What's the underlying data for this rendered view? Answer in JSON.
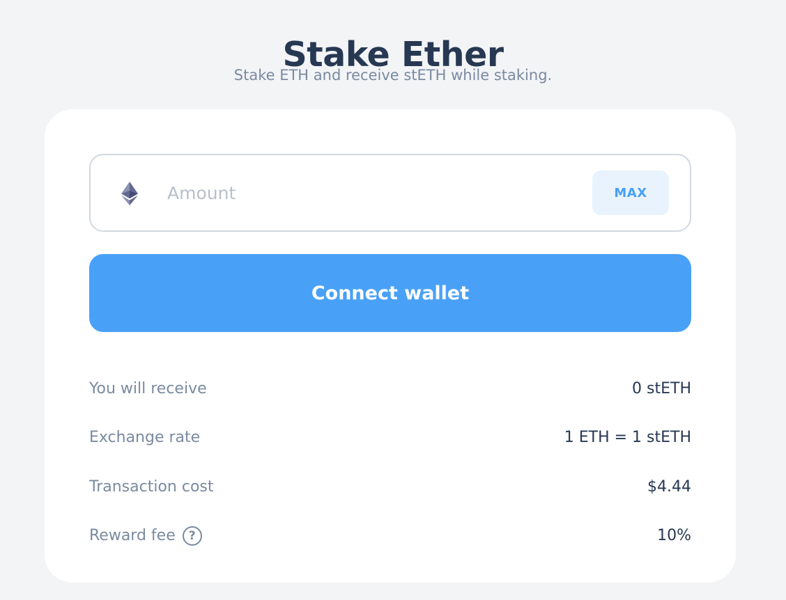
{
  "header": {
    "title": "Stake Ether",
    "subtitle": "Stake ETH and receive stETH while staking."
  },
  "form": {
    "token_icon": "ethereum-icon",
    "amount_placeholder": "Amount",
    "amount_value": "",
    "max_label": "MAX",
    "connect_label": "Connect wallet"
  },
  "details": [
    {
      "label": "You will receive",
      "value": "0 stETH",
      "help": false
    },
    {
      "label": "Exchange rate",
      "value": "1 ETH = 1 stETH",
      "help": false
    },
    {
      "label": "Transaction cost",
      "value": "$4.44",
      "help": false
    },
    {
      "label": "Reward fee",
      "value": "10%",
      "help": true,
      "help_icon": "question-circle-icon",
      "help_glyph": "?"
    }
  ],
  "colors": {
    "background": "#f2f4f6",
    "card": "#ffffff",
    "title": "#273852",
    "muted_text": "#7a8aa0",
    "accent": "#49a1f7",
    "max_bg": "#e9f3fd",
    "input_border": "#d1d8df"
  }
}
